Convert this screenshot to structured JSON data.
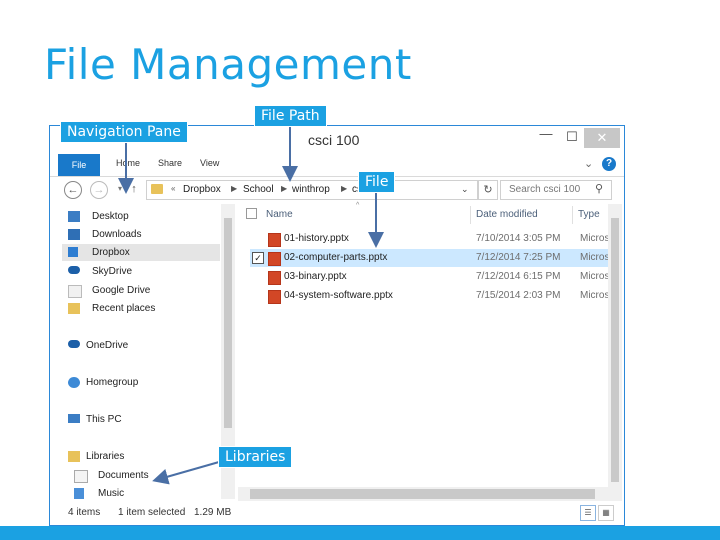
{
  "slide": {
    "title": "File Management"
  },
  "callouts": {
    "navigation_pane": "Navigation Pane",
    "file_path": "File Path",
    "file": "File",
    "libraries": "Libraries"
  },
  "window": {
    "title": "csci 100",
    "controls": {
      "minimize": "—",
      "maximize": "☐",
      "close": "✕"
    }
  },
  "ribbon": {
    "tabs": [
      "File",
      "Home",
      "Share",
      "View"
    ],
    "expand_icon": "chevron-down-icon",
    "help_icon": "help-icon",
    "help_label": "?"
  },
  "address": {
    "crumbs": [
      "Dropbox",
      "School",
      "winthrop",
      "csci 100"
    ],
    "lead_separator": "«",
    "search_placeholder": "Search csci 100"
  },
  "nav_pane": {
    "items": [
      {
        "label": "Desktop",
        "icon": "desktop-icon"
      },
      {
        "label": "Downloads",
        "icon": "downloads-icon"
      },
      {
        "label": "Dropbox",
        "icon": "dropbox-icon",
        "selected": true
      },
      {
        "label": "SkyDrive",
        "icon": "skydrive-icon"
      },
      {
        "label": "Google Drive",
        "icon": "google-drive-icon"
      },
      {
        "label": "Recent places",
        "icon": "recent-places-icon"
      },
      {
        "label": "OneDrive",
        "icon": "onedrive-icon"
      },
      {
        "label": "Homegroup",
        "icon": "homegroup-icon"
      },
      {
        "label": "This PC",
        "icon": "this-pc-icon"
      },
      {
        "label": "Libraries",
        "icon": "libraries-icon"
      },
      {
        "label": "Documents",
        "icon": "documents-icon"
      },
      {
        "label": "Music",
        "icon": "music-icon"
      }
    ]
  },
  "file_list": {
    "columns": {
      "name": "Name",
      "date": "Date modified",
      "type": "Type"
    },
    "rows": [
      {
        "name": "01-history.pptx",
        "date": "7/10/2014 3:05 PM",
        "type": "Microsof",
        "selected": false
      },
      {
        "name": "02-computer-parts.pptx",
        "date": "7/12/2014 7:25 PM",
        "type": "Microsof",
        "selected": true
      },
      {
        "name": "03-binary.pptx",
        "date": "7/12/2014 6:15 PM",
        "type": "Microsof",
        "selected": false
      },
      {
        "name": "04-system-software.pptx",
        "date": "7/15/2014 2:03 PM",
        "type": "Microsof",
        "selected": false
      }
    ],
    "checkmark": "✓"
  },
  "status": {
    "count": "4 items",
    "selection": "1 item selected",
    "size": "1.29 MB"
  },
  "colors": {
    "accent": "#1ba1e2",
    "selection": "#cce8ff",
    "ribbon_file": "#1979ca",
    "arrow": "#4a6fa5"
  }
}
